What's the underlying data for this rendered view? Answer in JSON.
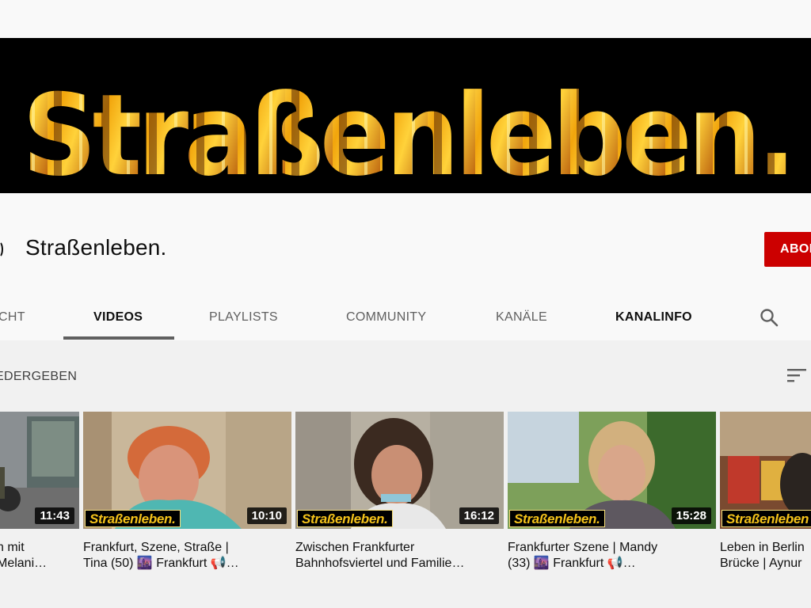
{
  "banner": {
    "text": "Straßenleben."
  },
  "channel": {
    "name": "Straßenleben.",
    "subscribe_label": "ABON"
  },
  "tabs": [
    {
      "label": "CHT",
      "selected": false,
      "bold": false
    },
    {
      "label": "VIDEOS",
      "selected": true,
      "bold": true
    },
    {
      "label": "PLAYLISTS",
      "selected": false,
      "bold": false
    },
    {
      "label": "COMMUNITY",
      "selected": false,
      "bold": false
    },
    {
      "label": "KANÄLE",
      "selected": false,
      "bold": false
    },
    {
      "label": "KANALINFO",
      "selected": false,
      "bold": true
    }
  ],
  "toolbar": {
    "play_all_label": "EDERGEBEN"
  },
  "icons": {
    "search": "search-icon",
    "sort": "sort-icon"
  },
  "colors": {
    "subscribe": "#cc0000",
    "banner_text": "#f4c21a",
    "background": "#f9f9f9"
  },
  "videos": [
    {
      "duration": "11:43",
      "brand": "",
      "title": "n mit\n Melani…"
    },
    {
      "duration": "10:10",
      "brand": "Straßenleben.",
      "title": "Frankfurt, Szene, Straße |\nTina (50) 🌆 Frankfurt 📢…"
    },
    {
      "duration": "16:12",
      "brand": "Straßenleben.",
      "title": "Zwischen Frankfurter\nBahnhofsviertel und Familie…"
    },
    {
      "duration": "15:28",
      "brand": "Straßenleben.",
      "title": "Frankfurter Szene | Mandy\n(33) 🌆 Frankfurt 📢…"
    },
    {
      "duration": "",
      "brand": "Straßenleben",
      "title": "Leben in Berlin\nBrücke | Aynur"
    }
  ]
}
